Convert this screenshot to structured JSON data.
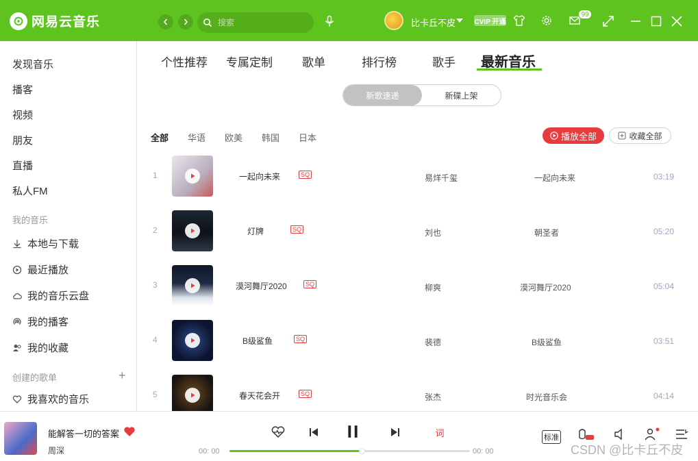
{
  "header": {
    "app_title": "网易云音乐",
    "search_placeholder": "搜索",
    "username": "比卡丘不皮",
    "vip_label": "CVIP 开通",
    "message_count": "99",
    "brand_color": "#5fc31f"
  },
  "sidebar": {
    "items": [
      {
        "label": "发现音乐"
      },
      {
        "label": "播客"
      },
      {
        "label": "视频"
      },
      {
        "label": "朋友"
      },
      {
        "label": "直播"
      },
      {
        "label": "私人FM"
      }
    ],
    "my_music_heading": "我的音乐",
    "my_music": [
      {
        "label": "本地与下载",
        "icon": "download-icon"
      },
      {
        "label": "最近播放",
        "icon": "recent-play-icon"
      },
      {
        "label": "我的音乐云盘",
        "icon": "cloud-icon"
      },
      {
        "label": "我的播客",
        "icon": "podcast-icon"
      },
      {
        "label": "我的收藏",
        "icon": "collection-icon"
      }
    ],
    "created_heading": "创建的歌单",
    "created": [
      {
        "label": "我喜欢的音乐",
        "icon": "heart-icon"
      }
    ]
  },
  "tabs": [
    "个性推荐",
    "专属定制",
    "歌单",
    "排行榜",
    "歌手",
    "最新音乐"
  ],
  "segment": [
    "新歌速递",
    "新碟上架"
  ],
  "filters": [
    "全部",
    "华语",
    "欧美",
    "韩国",
    "日本"
  ],
  "actions": {
    "play_all": "播放全部",
    "collect_all": "收藏全部"
  },
  "songs": [
    {
      "index": "1",
      "title": "一起向未来",
      "quality": "SQ",
      "artist": "易烊千玺",
      "album": "一起向未来",
      "duration": "03:19"
    },
    {
      "index": "2",
      "title": "灯牌",
      "quality": "SQ",
      "artist": "刘也",
      "album": "朝圣者",
      "duration": "05:20"
    },
    {
      "index": "3",
      "title": "漠河舞厅2020",
      "quality": "SQ",
      "artist": "柳爽",
      "album": "漠河舞厅2020",
      "duration": "05:04"
    },
    {
      "index": "4",
      "title": "B级鲨鱼",
      "quality": "SQ",
      "artist": "裴德",
      "album": "B级鲨鱼",
      "duration": "03:51"
    },
    {
      "index": "5",
      "title": "春天花会开",
      "quality": "SQ",
      "artist": "张杰",
      "album": "时光音乐会",
      "duration": "04:14"
    }
  ],
  "player": {
    "title": "能解答一切的答案",
    "artist": "周深",
    "current_time": "00: 00",
    "total_time": "00: 00",
    "progress": 0.55,
    "quality": "标准",
    "lyric_label": "词"
  },
  "watermark": "CSDN @比卡丘不皮"
}
